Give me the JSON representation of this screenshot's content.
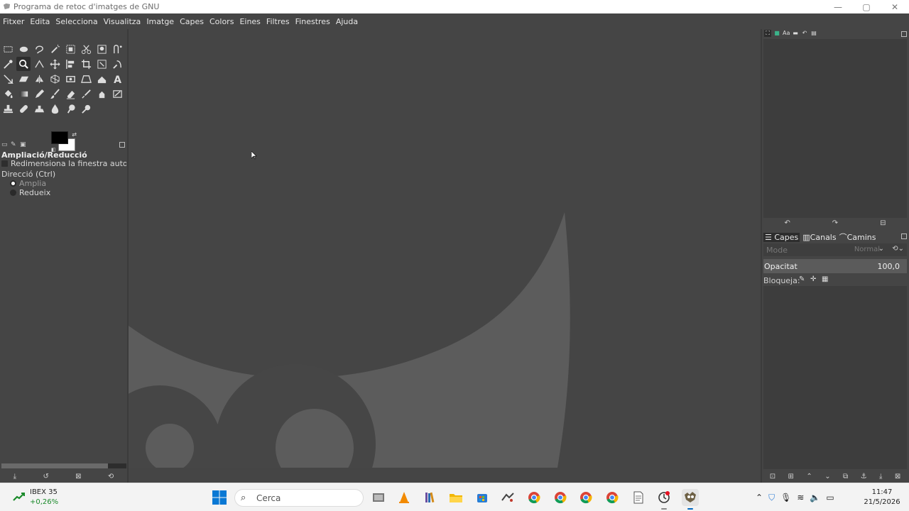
{
  "window": {
    "title": "Programa de retoc d'imatges de GNU",
    "minimize_glyph": "—",
    "maximize_glyph": "▢",
    "close_glyph": "✕"
  },
  "menubar": {
    "items": [
      "Fitxer",
      "Edita",
      "Selecciona",
      "Visualitza",
      "Imatge",
      "Capes",
      "Colors",
      "Eines",
      "Filtres",
      "Finestres",
      "Ajuda"
    ]
  },
  "toolbox": {
    "active_tool": "zoom-tool"
  },
  "tool_options": {
    "title": "Ampliació/Reducció",
    "auto_resize_label": "Redimensiona la finestra automàtica",
    "direction_label": "Direcció (Ctrl)",
    "zoom_in_label": "Amplia",
    "zoom_out_label": "Redueix"
  },
  "layers": {
    "tabs": [
      "Capes",
      "Canals",
      "Camins"
    ],
    "mode_label": "Mode",
    "mode_value": "Normal",
    "opacity_label": "Opacitat",
    "opacity_value": "100,0",
    "lock_label": "Bloqueja:"
  },
  "taskbar": {
    "stock_name": "IBEX 35",
    "stock_change": "+0,26%",
    "search_placeholder": "Cerca",
    "time": "11:47",
    "date": "21/5/2026"
  },
  "colors": {
    "canvas_bg": "#454545",
    "wilber_shape": "#5c5c5c",
    "stock_green": "#1a8a2a",
    "taskbar_bg": "#f3f3f3"
  }
}
